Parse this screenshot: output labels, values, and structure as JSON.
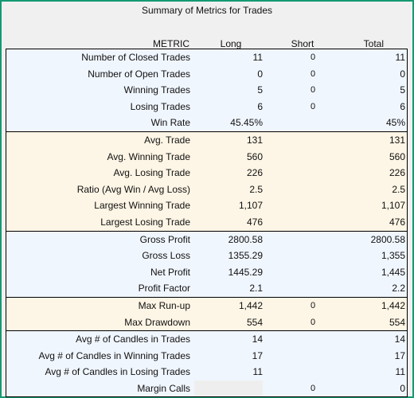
{
  "title": "Summary of Metrics for Trades",
  "columns": {
    "metric": "METRIC",
    "long": "Long",
    "short": "Short",
    "total": "Total"
  },
  "colors": {
    "frame": "#149a72",
    "section_blue": "#f0f6fe",
    "section_cream": "#fdf5e5",
    "disabled_cell": "#eeeeee"
  },
  "sections": [
    {
      "style": "blue",
      "rows": [
        {
          "metric": "Number of Closed Trades",
          "long": "11",
          "short": "0",
          "total": "11"
        },
        {
          "metric": "Number of Open Trades",
          "long": "0",
          "short": "0",
          "total": "0"
        },
        {
          "metric": "Winning Trades",
          "long": "5",
          "short": "0",
          "total": "5"
        },
        {
          "metric": "Losing Trades",
          "long": "6",
          "short": "0",
          "total": "6"
        },
        {
          "metric": "Win Rate",
          "long": "45.45%",
          "short": "",
          "total": "45%"
        }
      ]
    },
    {
      "style": "cream",
      "rows": [
        {
          "metric": "Avg. Trade",
          "long": "131",
          "short": "",
          "total": "131"
        },
        {
          "metric": "Avg. Winning Trade",
          "long": "560",
          "short": "",
          "total": "560"
        },
        {
          "metric": "Avg. Losing Trade",
          "long": "226",
          "short": "",
          "total": "226"
        },
        {
          "metric": "Ratio (Avg Win / Avg Loss)",
          "long": "2.5",
          "short": "",
          "total": "2.5"
        },
        {
          "metric": "Largest Winning Trade",
          "long": "1,107",
          "short": "",
          "total": "1,107"
        },
        {
          "metric": "Largest Losing Trade",
          "long": "476",
          "short": "",
          "total": "476"
        }
      ]
    },
    {
      "style": "blue",
      "rows": [
        {
          "metric": "Gross Profit",
          "long": "2800.58",
          "short": "",
          "total": "2800.58"
        },
        {
          "metric": "Gross Loss",
          "long": "1355.29",
          "short": "",
          "total": "1,355"
        },
        {
          "metric": "Net Profit",
          "long": "1445.29",
          "short": "",
          "total": "1,445"
        },
        {
          "metric": "Profit Factor",
          "long": "2.1",
          "short": "",
          "total": "2.2"
        }
      ]
    },
    {
      "style": "cream",
      "rows": [
        {
          "metric": "Max Run-up",
          "long": "1,442",
          "short": "0",
          "total": "1,442"
        },
        {
          "metric": "Max Drawdown",
          "long": "554",
          "short": "0",
          "total": "554"
        }
      ]
    },
    {
      "style": "blue",
      "rows": [
        {
          "metric": "Avg # of Candles in Trades",
          "long": "14",
          "short": "",
          "total": "14"
        },
        {
          "metric": "Avg # of Candles in Winning Trades",
          "long": "17",
          "short": "",
          "total": "17"
        },
        {
          "metric": "Avg # of Candles in Losing Trades",
          "long": "11",
          "short": "",
          "total": "11"
        },
        {
          "metric": "Margin Calls",
          "long": "",
          "short": "0",
          "total": "0",
          "long_disabled": true
        }
      ]
    }
  ]
}
